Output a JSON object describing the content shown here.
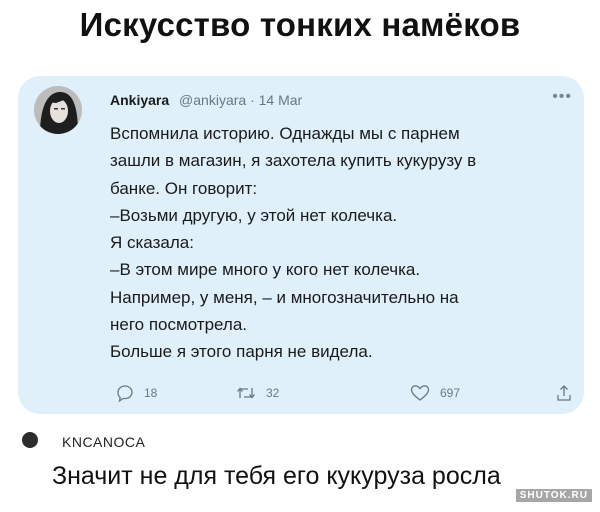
{
  "header": {
    "title": "Искусство тонких намёков"
  },
  "tweet": {
    "author": "Ankiyara",
    "handle": "@ankiyara",
    "separator": "·",
    "date": "14 Mar",
    "more_icon": "more-dots-icon",
    "lines": [
      "Вспомнила историю. Однажды мы с парнем",
      "зашли в магазин, я захотела купить кукурузу в",
      "банке. Он говорит:",
      "–Возьми другую, у этой нет колечка.",
      "Я сказала:",
      "–В этом мире много у кого нет колечка.",
      "Например, у меня, – и многозначительно на",
      "него посмотрела.",
      "Больше я этого парня не видела."
    ],
    "actions": {
      "reply_count": "18",
      "retweet_count": "32",
      "like_count": "697"
    }
  },
  "comment": {
    "username": "KNCANOCA",
    "text": "Значит не для тебя его кукуруза росла"
  },
  "watermark": "SHUTOK.RU",
  "colors": {
    "card_background": "#dff0fa",
    "muted_text": "#6b7784"
  }
}
